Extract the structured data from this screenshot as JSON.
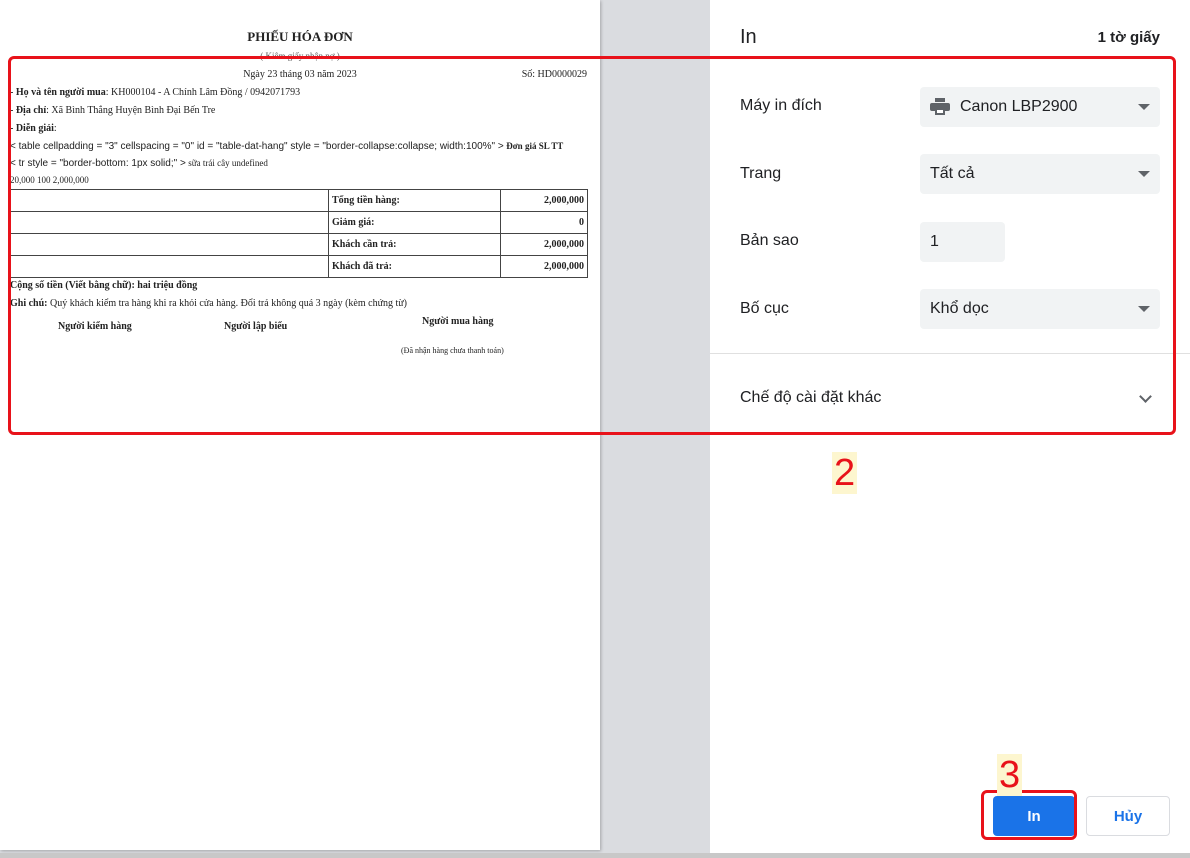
{
  "document": {
    "title": "PHIẾU HÓA ĐƠN",
    "subtitle": "( Kiêm giấy nhận nợ )",
    "date": "Ngày 23 tháng 03 năm 2023",
    "number": "Số: HD0000029",
    "buyer_label": "- Họ và tên người mua",
    "buyer_value": ": KH000104 - A Chính Lâm Đồng / 0942071793",
    "address_label": "- Địa chỉ",
    "address_value": ": Xã Bình Thắng Huyện Bình Đại Bến Tre",
    "description_label": "- Diễn giải",
    "description_value": ":",
    "raw_html_line1": "< table cellpadding = \"3\" cellspacing = \"0\" id = \"table-dat-hang\" style = \"border-collapse:collapse; width:100%\" >",
    "raw_html_line1_tail": "Đơn giá SL TT",
    "raw_html_line2": "< tr style = \"border-bottom: 1px solid;\" >",
    "raw_html_line2_tail": "sữa trái cây undefined",
    "item_values": "20,000 100 2,000,000",
    "totals": [
      {
        "label": "Tổng tiền hàng:",
        "value": "2,000,000"
      },
      {
        "label": "Giảm giá:",
        "value": "0"
      },
      {
        "label": "Khách cần trả:",
        "value": "2,000,000"
      },
      {
        "label": "Khách đã trả:",
        "value": "2,000,000"
      }
    ],
    "amount_words": "Cộng số tiền (Viết bằng chữ): hai triệu đồng",
    "note_label": "Ghi chú:",
    "note_value": "Quý khách kiểm tra hàng khi ra khỏi cửa hàng. Đổi trả không quá 3 ngày (kèm chứng từ)",
    "sign_checker": "Người kiểm hàng",
    "sign_creator": "Người lập biểu",
    "sign_buyer": "Người mua hàng",
    "sign_buyer_note": "(Đã nhận hàng chưa thanh toán)"
  },
  "panel": {
    "title": "In",
    "sheet_count": "1 tờ giấy",
    "destination_label": "Máy in đích",
    "destination_value": "Canon LBP2900",
    "pages_label": "Trang",
    "pages_value": "Tất cả",
    "copies_label": "Bản sao",
    "copies_value": "1",
    "layout_label": "Bố cục",
    "layout_value": "Khổ dọc",
    "more_settings": "Chế độ cài đặt khác",
    "print_button": "In",
    "cancel_button": "Hủy"
  },
  "annotations": {
    "step2": "2",
    "step3": "3",
    "color": "#e8121a"
  },
  "icons": [
    "printer-icon",
    "dropdown-arrow-icon",
    "chevron-down-icon"
  ]
}
